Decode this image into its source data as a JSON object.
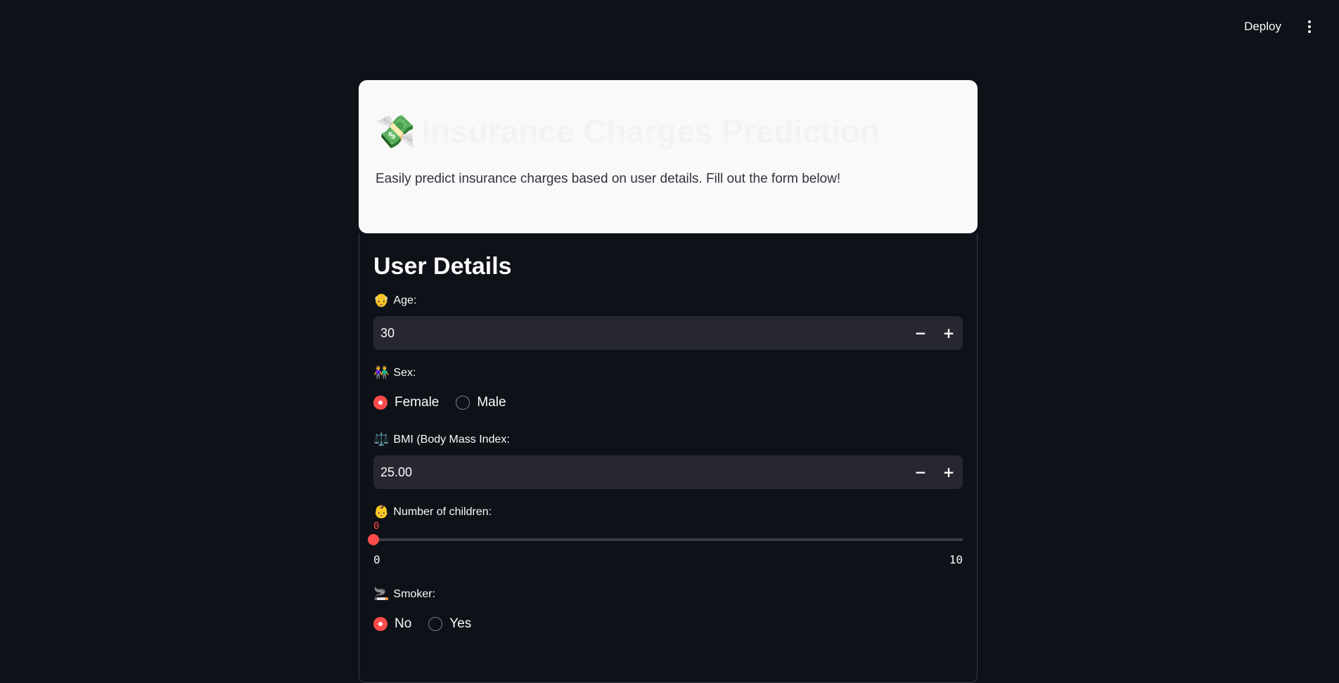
{
  "toolbar": {
    "deploy_label": "Deploy",
    "menu_icon": "vertical-ellipsis-icon"
  },
  "header": {
    "emoji": "💸",
    "title": "Insurance Charges Prediction",
    "subtitle": "Easily predict insurance charges based on user details. Fill out the form below!"
  },
  "form": {
    "section_title": "User Details",
    "age": {
      "icon": "👴",
      "label": "Age:",
      "value": "30",
      "minus": "−",
      "plus": "+"
    },
    "sex": {
      "icon": "👫",
      "label": "Sex:",
      "options": [
        "Female",
        "Male"
      ],
      "selected": "Female"
    },
    "bmi": {
      "icon": "⚖️",
      "label": "BMI (Body Mass Index:",
      "value": "25.00",
      "minus": "−",
      "plus": "+"
    },
    "children": {
      "icon": "👶",
      "label": "Number of children:",
      "value": "0",
      "min": "0",
      "max": "10",
      "fraction": 0
    },
    "smoker": {
      "icon": "🚬",
      "label": "Smoker:",
      "options": [
        "No",
        "Yes"
      ],
      "selected": "No"
    }
  },
  "colors": {
    "background": "#0e1117",
    "accent": "#ff4b4b",
    "input_bg": "#262730",
    "header_bg": "#f9f9f9"
  }
}
